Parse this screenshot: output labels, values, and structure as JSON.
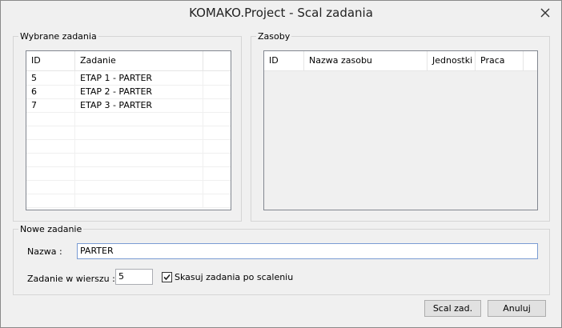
{
  "window": {
    "title": "KOMAKO.Project - Scal zadania"
  },
  "selected_tasks": {
    "legend": "Wybrane zadania",
    "columns": [
      "ID",
      "Zadanie"
    ],
    "rows": [
      {
        "id": "5",
        "name": "ETAP 1 - PARTER"
      },
      {
        "id": "6",
        "name": "ETAP 2 - PARTER"
      },
      {
        "id": "7",
        "name": "ETAP 3 - PARTER"
      }
    ]
  },
  "resources": {
    "legend": "Zasoby",
    "columns": [
      "ID",
      "Nazwa zasobu",
      "Jednostki",
      "Praca"
    ]
  },
  "new_task": {
    "legend": "Nowe zadanie",
    "name_label": "Nazwa :",
    "name_value": "PARTER",
    "per_row_label": "Zadanie w wierszu :",
    "per_row_value": "5",
    "delete_label": "Skasuj zadania po scaleniu",
    "delete_checked": true
  },
  "buttons": {
    "merge": "Scal zad.",
    "cancel": "Anuluj"
  }
}
